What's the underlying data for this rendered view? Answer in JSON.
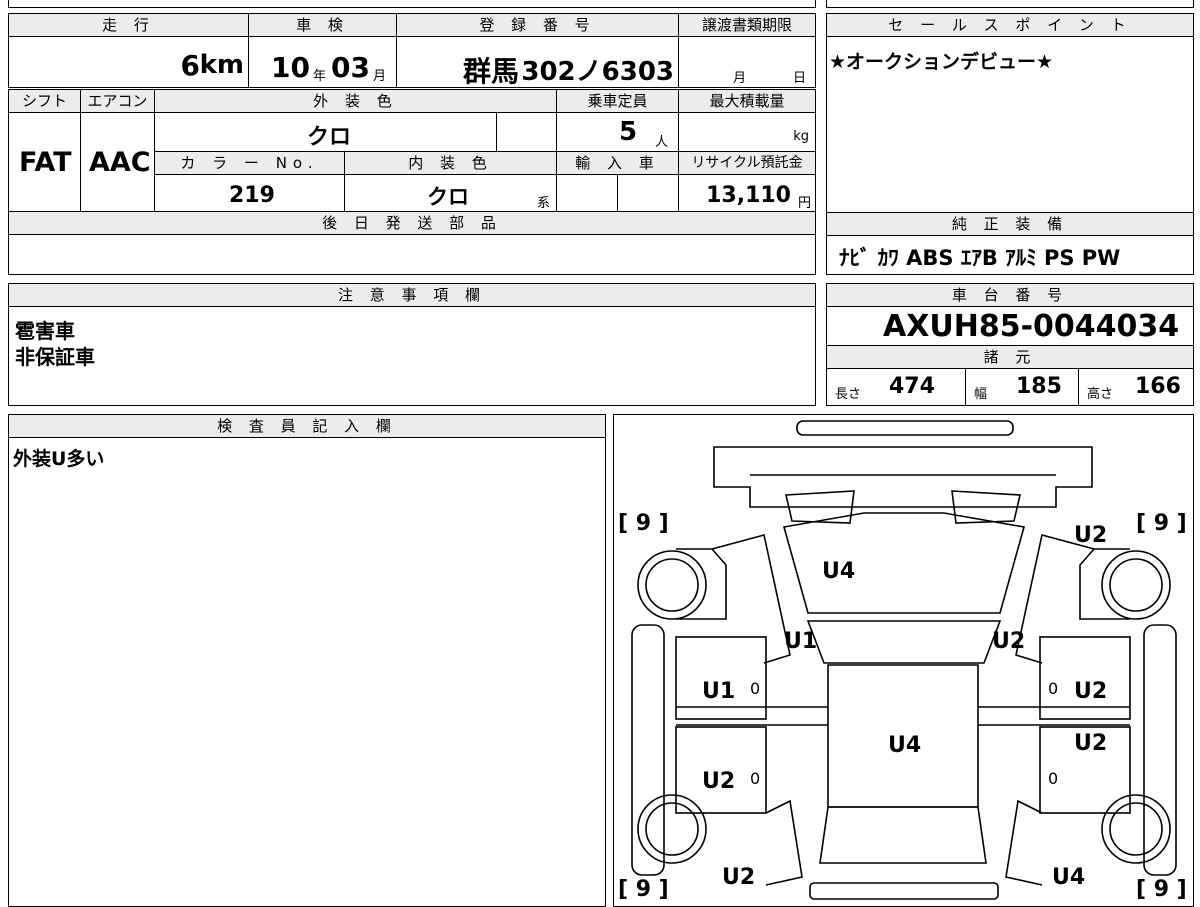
{
  "top_strip": [
    "",
    "",
    "",
    "",
    ""
  ],
  "main": {
    "mileage_label": "走 行",
    "mileage_value": "6",
    "mileage_unit": "km",
    "inspection_label": "車 検",
    "inspection_year": "10",
    "inspection_year_unit": "年",
    "inspection_month": "03",
    "inspection_month_unit": "月",
    "reg_label": "登 録 番 号",
    "reg_region": "群馬",
    "reg_number": "302ノ6303",
    "transfer_label": "譲渡書類期限",
    "transfer_month_unit": "月",
    "transfer_day_unit": "日",
    "shift_label": "シフト",
    "shift_value": "FAT",
    "ac_label": "エアコン",
    "ac_value": "AAC",
    "exterior_label": "外 装 色",
    "exterior_value": "クロ",
    "capacity_label": "乗車定員",
    "capacity_value": "5",
    "capacity_unit": "人",
    "maxload_label": "最大積載量",
    "maxload_unit": "kg",
    "colorno_label": "カ ラ ー No.",
    "colorno_value": "219",
    "interior_label": "内 装 色",
    "interior_value": "クロ",
    "interior_unit": "系",
    "import_label": "輸 入 車",
    "recycle_label": "リサイクル預託金",
    "recycle_value": "13,110",
    "recycle_unit": "円",
    "later_parts_label": "後 日 発 送 部 品"
  },
  "sales_point": {
    "label": "セ ー ル ス ポ イ ン ト",
    "text": "★オークションデビュー★"
  },
  "equipment": {
    "label": "純 正 装 備",
    "items": "ﾅﾋﾞ ｶﾜ ABS ｴｱB ｱﾙﾐ PS PW"
  },
  "notes": {
    "label": "注 意 事 項 欄",
    "lines": [
      "雹害車",
      "非保証車"
    ]
  },
  "chassis": {
    "label": "車 台 番 号",
    "number": "AXUH85-0044034",
    "spec_label": "諸 元",
    "length_label": "長さ",
    "length_value": "474",
    "width_label": "幅",
    "width_value": "185",
    "height_label": "高さ",
    "height_value": "166"
  },
  "inspector": {
    "label": "検 査 員 記 入 欄",
    "text": "外装U多い"
  },
  "diagram": {
    "tire_tl": "[ 9 ]",
    "tire_tr": "[ 9 ]",
    "tire_bl": "[ 9 ]",
    "tire_br": "[ 9 ]",
    "hood": "U4",
    "front_right": "U2",
    "pillar_left": "U1",
    "pillar_right": "U2",
    "door_left_front": "U1",
    "door_left_front_zero": "0",
    "door_right_front_zero": "0",
    "door_right_front": "U2",
    "roof": "U4",
    "door_right_rear": "U2",
    "door_left_rear": "U2",
    "door_left_rear_zero": "0",
    "door_right_rear_zero": "0",
    "rear_left": "U2",
    "rear_right": "U4"
  }
}
